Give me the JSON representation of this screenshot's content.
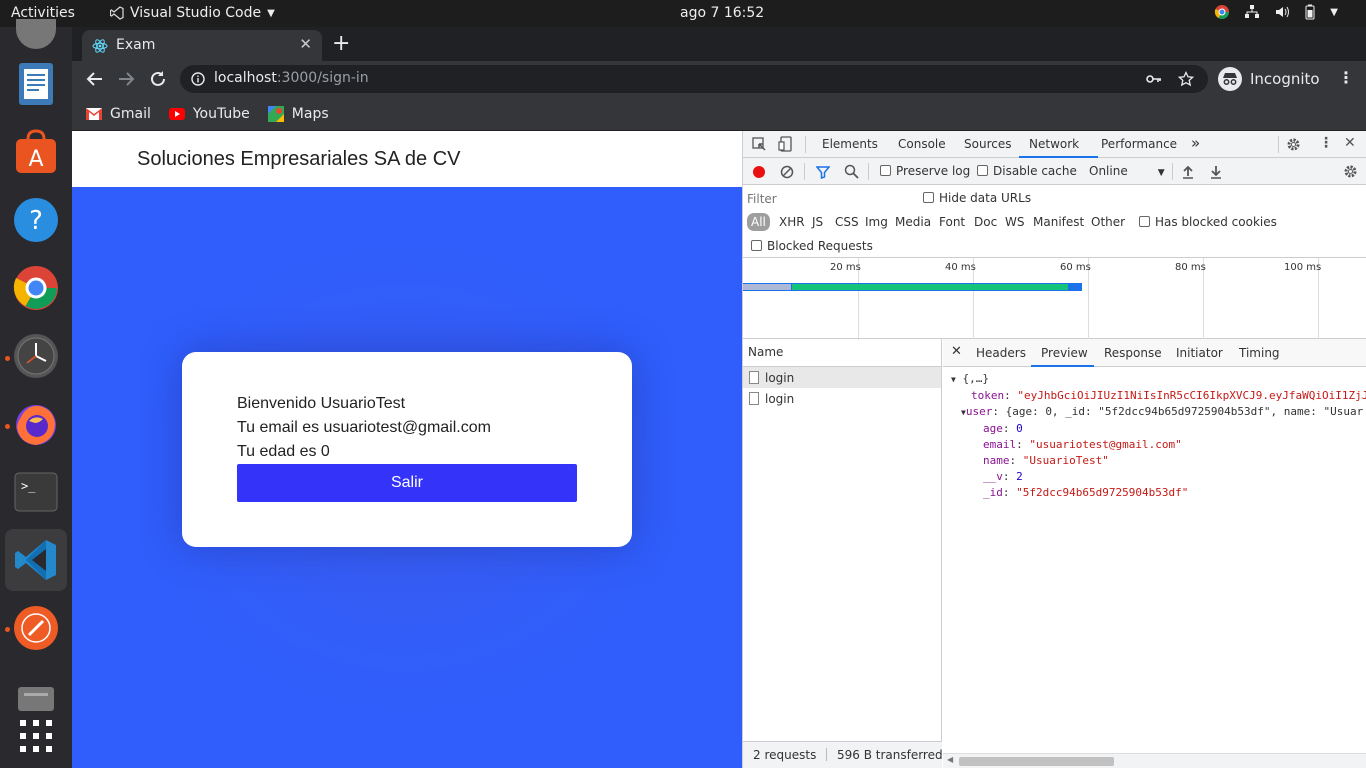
{
  "topbar": {
    "activities": "Activities",
    "app_name": "Visual Studio Code",
    "clock": "ago 7  16:52"
  },
  "browser": {
    "tab_title": "Exam",
    "url_host": "localhost",
    "url_rest": ":3000/sign-in",
    "incognito_label": "Incognito",
    "bookmarks": [
      "Gmail",
      "YouTube",
      "Maps"
    ]
  },
  "page": {
    "brand": "Soluciones Empresariales SA de CV",
    "welcome": "Bienvenido UsuarioTest",
    "email_line": "Tu email es usuariotest@gmail.com",
    "age_line": "Tu edad es 0",
    "logout_label": "Salir"
  },
  "devtools": {
    "tabs": [
      "Elements",
      "Console",
      "Sources",
      "Network",
      "Performance"
    ],
    "active_tab": "Network",
    "preserve_log": "Preserve log",
    "disable_cache": "Disable cache",
    "throttle": "Online",
    "filter_placeholder": "Filter",
    "hide_data_urls": "Hide data URLs",
    "type_filters": [
      "All",
      "XHR",
      "JS",
      "CSS",
      "Img",
      "Media",
      "Font",
      "Doc",
      "WS",
      "Manifest",
      "Other"
    ],
    "has_blocked_cookies": "Has blocked cookies",
    "blocked_requests": "Blocked Requests",
    "timeline_labels": [
      "20 ms",
      "40 ms",
      "60 ms",
      "80 ms",
      "100 ms"
    ],
    "name_header": "Name",
    "requests": [
      "login",
      "login"
    ],
    "detail_tabs": [
      "Headers",
      "Preview",
      "Response",
      "Initiator",
      "Timing"
    ],
    "active_detail_tab": "Preview",
    "preview": {
      "root": "{,…}",
      "token_key": "token",
      "token_value": "\"eyJhbGciOiJIUzI1NiIsInR5cCI6IkpXVCJ9.eyJfaWQiOiI1ZjJ",
      "user_key": "user",
      "user_summary": "{age: 0, _id: \"5f2dcc94b65d9725904b53df\", name: \"Usuar",
      "age_key": "age",
      "age_value": "0",
      "email_key": "email",
      "email_value": "\"usuariotest@gmail.com\"",
      "name_key": "name",
      "name_value": "\"UsuarioTest\"",
      "v_key": "__v",
      "v_value": "2",
      "id_key": "_id",
      "id_value": "\"5f2dcc94b65d9725904b53df\""
    },
    "footer_requests": "2 requests",
    "footer_transferred": "596 B transferred"
  }
}
